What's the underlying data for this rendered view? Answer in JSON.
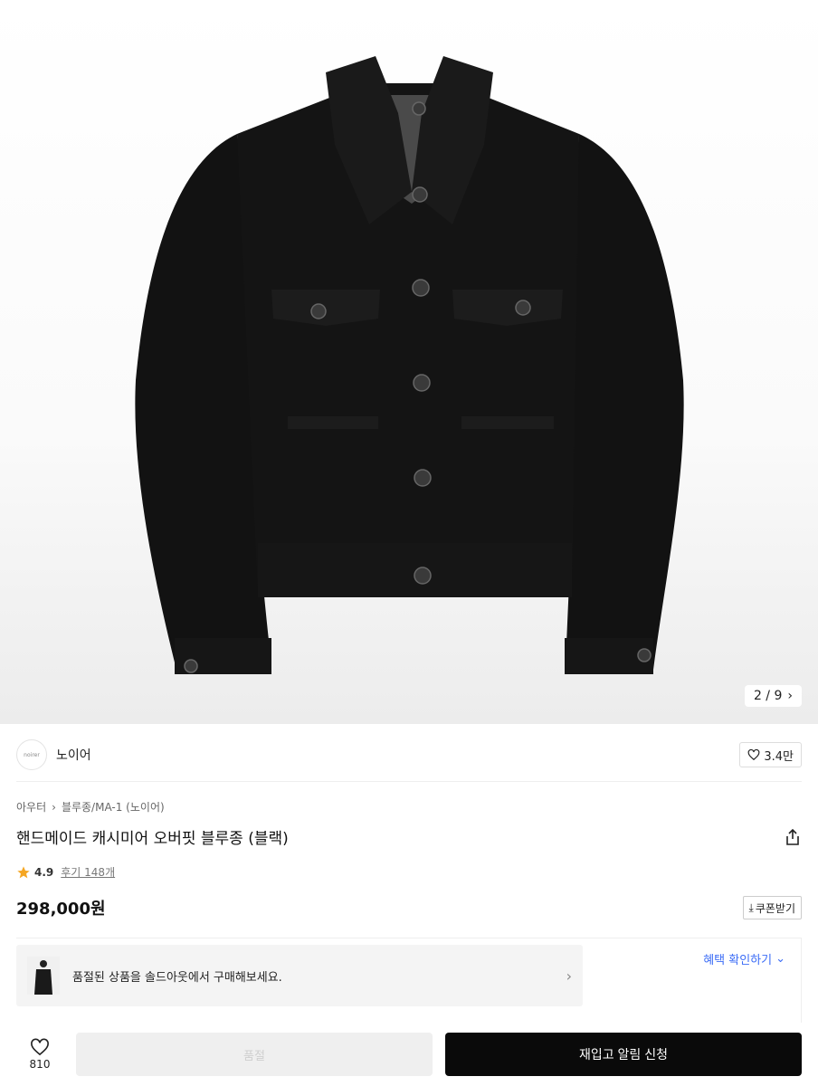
{
  "gallery": {
    "counter": "2 / 9",
    "image_alt_icon": "jacket-image"
  },
  "brand": {
    "logo_text": "noirer",
    "name": "노이어",
    "likes": "3.4만"
  },
  "breadcrumb": {
    "category": "아우터",
    "subcategory": "블루종/MA-1 (노이어)"
  },
  "product": {
    "title": "핸드메이드 캐시미어 오버핏 블루종 (블랙)",
    "rating": "4.9",
    "reviews": "후기 148개",
    "price": "298,000원"
  },
  "coupon": {
    "label": "쿠폰받기"
  },
  "benefit": {
    "label": "혜택 확인하기"
  },
  "soldout_banner": {
    "text": "품절된 상품을 솔드아웃에서 구매해보세요."
  },
  "bottom_bar": {
    "wish_count": "810",
    "soldout_label": "품절",
    "restock_label": "재입고 알림 신청"
  },
  "colors": {
    "accent_link": "#3b6cf6",
    "star": "#f5a623",
    "primary_button": "#0a0a0a"
  }
}
